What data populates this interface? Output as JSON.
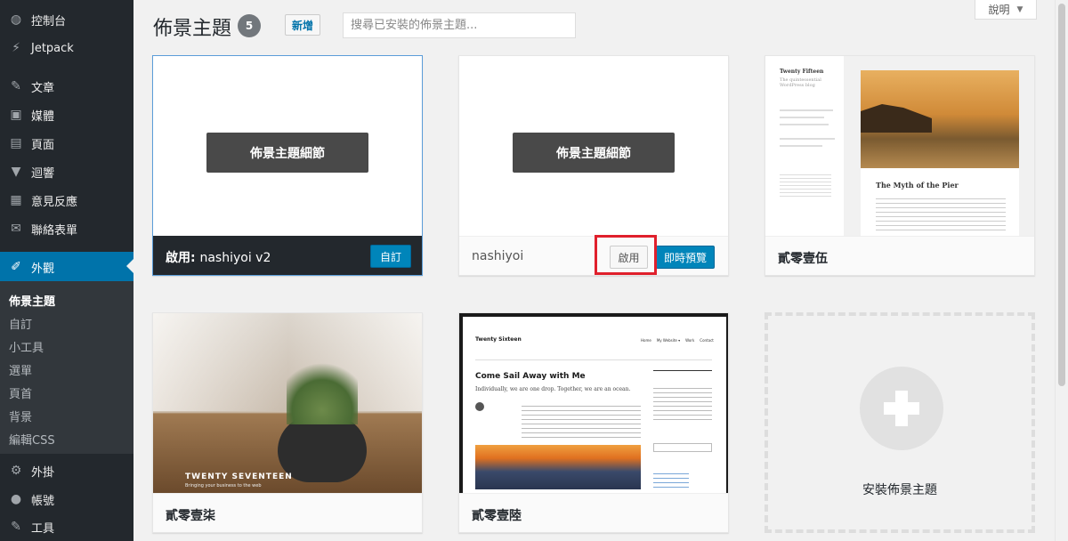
{
  "sidebar": {
    "items": [
      {
        "label": "控制台",
        "icon": "dashboard-icon",
        "glyph": "◍"
      },
      {
        "label": "Jetpack",
        "icon": "jetpack-icon",
        "glyph": "⚡"
      },
      {
        "label": "文章",
        "icon": "pin-icon",
        "glyph": "✎"
      },
      {
        "label": "媒體",
        "icon": "media-icon",
        "glyph": "▣"
      },
      {
        "label": "頁面",
        "icon": "page-icon",
        "glyph": "▤"
      },
      {
        "label": "迴響",
        "icon": "comment-icon",
        "glyph": "▼"
      },
      {
        "label": "意見反應",
        "icon": "feedback-icon",
        "glyph": "▦"
      },
      {
        "label": "聯絡表單",
        "icon": "mail-icon",
        "glyph": "✉"
      },
      {
        "label": "外觀",
        "icon": "appearance-icon",
        "glyph": "✐"
      },
      {
        "label": "外掛",
        "icon": "plugin-icon",
        "glyph": "⚙"
      },
      {
        "label": "帳號",
        "icon": "user-icon",
        "glyph": "●"
      },
      {
        "label": "工具",
        "icon": "tools-icon",
        "glyph": "✎"
      }
    ],
    "submenu": [
      "佈景主題",
      "自訂",
      "小工具",
      "選單",
      "頁首",
      "背景",
      "編輯CSS"
    ]
  },
  "header": {
    "title": "佈景主題",
    "count": "5",
    "add_new": "新增",
    "search_placeholder": "搜尋已安裝的佈景主題...",
    "help": "說明",
    "help_arrow": "▼"
  },
  "themes": {
    "active": {
      "prefix": "啟用:",
      "name": "nashiyoi v2",
      "details": "佈景主題細節",
      "customize": "自訂"
    },
    "nashiyoi": {
      "name": "nashiyoi",
      "details": "佈景主題細節",
      "activate": "啟用",
      "preview": "即時預覽"
    },
    "fifteen": {
      "name": "貳零壹伍",
      "site_title": "Twenty Fifteen",
      "tagline": "The quintessential WordPress blog",
      "post_title": "The Myth of the Pier"
    },
    "seventeen": {
      "name": "貳零壹柒",
      "overlay": "TWENTY SEVENTEEN",
      "overlay_sub": "Bringing your business to the web"
    },
    "sixteen": {
      "name": "貳零壹陸",
      "site_title": "Twenty Sixteen",
      "nav": [
        "Home",
        "My Website ▾",
        "Work",
        "Contact"
      ],
      "post_title": "Come Sail Away with Me",
      "intro": "Individually, we are one drop. Together, we are an ocean."
    },
    "add_new_label": "安裝佈景主題"
  },
  "colors": {
    "sidebar": "#23282d",
    "accent": "#0073aa",
    "button": "#0085ba",
    "highlight": "#e0202c"
  }
}
